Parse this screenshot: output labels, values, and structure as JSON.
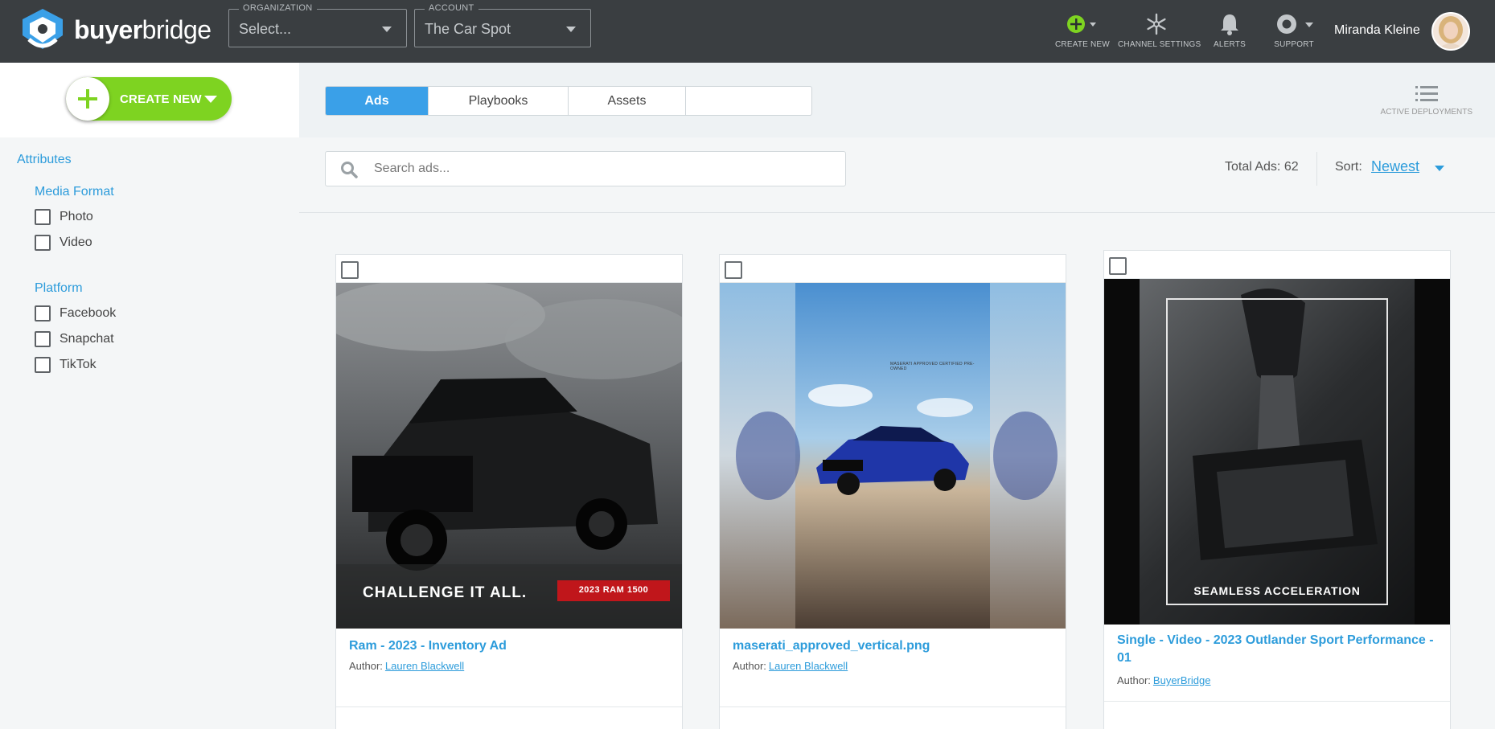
{
  "header": {
    "brand_bold": "buyer",
    "brand_light": "bridge",
    "organization": {
      "legend": "ORGANIZATION",
      "value": "Select..."
    },
    "account": {
      "legend": "ACCOUNT",
      "value": "The Car Spot"
    },
    "nav": {
      "create_new": "CREATE NEW",
      "channel_settings": "CHANNEL SETTINGS",
      "alerts": "ALERTS",
      "support": "SUPPORT"
    },
    "user_name": "Miranda Kleine"
  },
  "sidebar": {
    "create_button": "CREATE NEW",
    "attributes_heading": "Attributes",
    "media_format": {
      "heading": "Media Format",
      "options": [
        "Photo",
        "Video"
      ]
    },
    "platform": {
      "heading": "Platform",
      "options": [
        "Facebook",
        "Snapchat",
        "TikTok"
      ]
    }
  },
  "main": {
    "tabs": [
      {
        "label": "Ads",
        "active": true
      },
      {
        "label": "Playbooks",
        "active": false
      },
      {
        "label": "Assets",
        "active": false
      },
      {
        "label": "",
        "active": false
      }
    ],
    "active_deployments": "ACTIVE DEPLOYMENTS",
    "search_placeholder": "Search ads...",
    "total_ads": "Total Ads: 62",
    "sort_label": "Sort:",
    "sort_value": "Newest"
  },
  "cards": [
    {
      "title": "Ram - 2023 - Inventory Ad",
      "author_label": "Author:",
      "author": "Lauren Blackwell",
      "image_caption": "CHALLENGE IT ALL.",
      "image_badge": "2023 RAM 1500"
    },
    {
      "title": "maserati_approved_vertical.png",
      "author_label": "Author:",
      "author": "Lauren Blackwell",
      "image_badge": "MASERATI APPROVED CERTIFIED PRE-OWNED"
    },
    {
      "title": "Single - Video - 2023 Outlander Sport Performance - 01",
      "author_label": "Author:",
      "author": "BuyerBridge",
      "image_caption": "SEAMLESS ACCELERATION"
    }
  ],
  "colors": {
    "topbar": "#3a3e41",
    "accent_blue": "#2d9cdb",
    "tab_active": "#3aa0e8",
    "create_green": "#7ed321"
  }
}
